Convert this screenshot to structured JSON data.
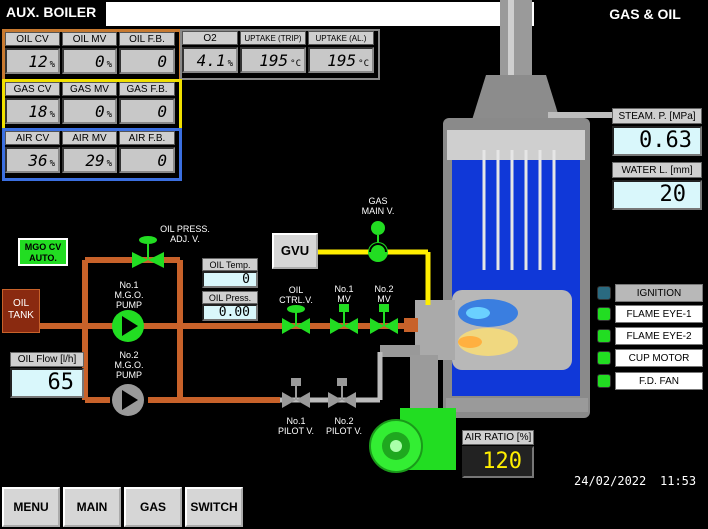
{
  "header": {
    "title": "AUX. BOILER",
    "mode": "GAS & OIL"
  },
  "oil_group": {
    "headers": [
      "OIL CV",
      "OIL MV",
      "OIL F.B."
    ],
    "values": [
      "12",
      "0",
      "0"
    ],
    "units": [
      "%",
      "%",
      ""
    ]
  },
  "gas_group": {
    "headers": [
      "GAS CV",
      "GAS MV",
      "GAS F.B."
    ],
    "values": [
      "18",
      "0",
      "0"
    ],
    "units": [
      "%",
      "%",
      ""
    ]
  },
  "air_group": {
    "headers": [
      "AIR CV",
      "AIR MV",
      "AIR F.B."
    ],
    "values": [
      "36",
      "29",
      "0"
    ],
    "units": [
      "%",
      "%",
      ""
    ]
  },
  "flue_group": {
    "headers": [
      "O2",
      "UPTAKE (TRIP)",
      "UPTAKE (AL.)"
    ],
    "values": [
      "4.1",
      "195",
      "195"
    ],
    "units": [
      "%",
      "°C",
      "°C"
    ]
  },
  "steam_p": {
    "label": "STEAM. P. [MPa]",
    "value": "0.63"
  },
  "water_l": {
    "label": "WATER L. [mm]",
    "value": "20"
  },
  "status": [
    {
      "label": "IGNITION",
      "on": false
    },
    {
      "label": "FLAME EYE-1",
      "on": true
    },
    {
      "label": "FLAME EYE-2",
      "on": true
    },
    {
      "label": "CUP MOTOR",
      "on": true
    },
    {
      "label": "F.D. FAN",
      "on": true
    }
  ],
  "mgo_cv_auto": {
    "line1": "MGO CV",
    "line2": "AUTO."
  },
  "oil_tank": {
    "line1": "OIL",
    "line2": "TANK"
  },
  "oil_flow": {
    "label": "OIL Flow [l/h]",
    "value": "65"
  },
  "oil_temp": {
    "label": "OIL Temp.",
    "value": "0"
  },
  "oil_press": {
    "label": "OIL Press.",
    "value": "0.00"
  },
  "gvu": {
    "label": "GVU"
  },
  "tags": {
    "oil_press_adj": [
      "OIL PRESS.",
      "ADJ. V."
    ],
    "gas_main": [
      "GAS",
      "MAIN V."
    ],
    "pump1": [
      "No.1",
      "M.G.O.",
      "PUMP"
    ],
    "pump2": [
      "No.2",
      "M.G.O.",
      "PUMP"
    ],
    "oil_ctrl": [
      "OIL",
      "CTRL.V."
    ],
    "mv1": [
      "No.1",
      "MV"
    ],
    "mv2": [
      "No.2",
      "MV"
    ],
    "pilot1": [
      "No.1",
      "PILOT V."
    ],
    "pilot2": [
      "No.2",
      "PILOT V."
    ]
  },
  "air_ratio": {
    "label": "AIR RATIO [%]",
    "value": "120"
  },
  "datetime": {
    "date": "24/02/2022",
    "time": "11:53"
  },
  "nav": [
    "MENU",
    "MAIN",
    "GAS",
    "SWITCH"
  ],
  "colors": {
    "oil_line": "#c8622a",
    "gas_line": "#ffee00",
    "water": "#1038d8",
    "green": "#22dd22",
    "oil_frame": "#c87a30",
    "gas_frame": "#f0e000",
    "air_frame": "#3b6fe0"
  }
}
